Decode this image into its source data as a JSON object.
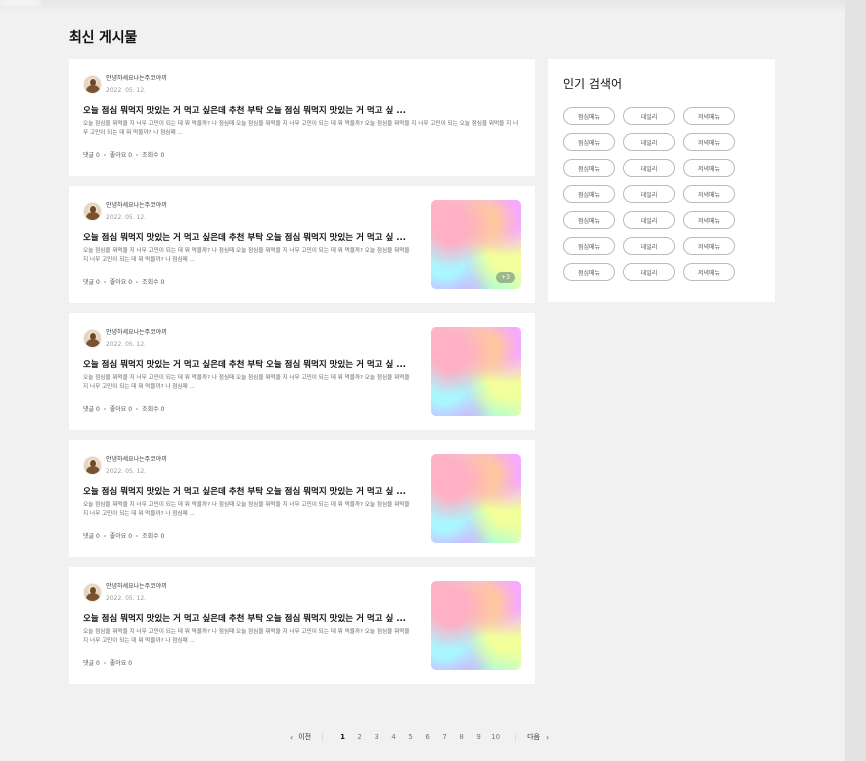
{
  "section_title": "최신 게시물",
  "posts": [
    {
      "author": "안녕하세요나는주코야끼",
      "date": "2022. 05. 12.",
      "title": "오늘 점심 뭐먹지 맛있는 거 먹고 싶은데 추천 부탁 오늘 점심 뭐먹지 맛있는 거 먹고 싶 ...",
      "excerpt": "오늘 점심을 뭐먹을 지 너무 고민이 되는 데 뭐 먹을까? 나 점심때 오늘 점심을 뭐먹을 지 너무 고민이 되는 데 뭐 먹을까? 오늘 점심을 뭐먹을 지 너무 고민이 되는 오늘 점심을 뭐먹을 지 너무 고민이 되는 데 뭐 먹을까? 나 점심때 ...",
      "comments": "댓글 0",
      "likes": "좋아요 0",
      "views": "조회수 0",
      "has_image": false,
      "extra_images": ""
    },
    {
      "author": "안녕하세요나는주코야끼",
      "date": "2022. 05. 12.",
      "title": "오늘 점심 뭐먹지 맛있는 거 먹고 싶은데 추천 부탁 오늘 점심 뭐먹지 맛있는 거 먹고 싶 ...",
      "excerpt": "오늘 점심을 뭐먹을 지 너무 고민이 되는 데 뭐 먹을까? 나 점심때 오늘 점심을 뭐먹을 지 너무 고민이 되는 데 뭐 먹을까? 오늘 점심을 뭐먹을 지 너무 고민이 되는 데 뭐 먹을까? 나 점심때 ...",
      "comments": "댓글 0",
      "likes": "좋아요 0",
      "views": "조회수 0",
      "has_image": true,
      "extra_images": "+3"
    },
    {
      "author": "안녕하세요나는주코야끼",
      "date": "2022. 05. 12.",
      "title": "오늘 점심 뭐먹지 맛있는 거 먹고 싶은데 추천 부탁 오늘 점심 뭐먹지 맛있는 거 먹고 싶 ...",
      "excerpt": "오늘 점심을 뭐먹을 지 너무 고민이 되는 데 뭐 먹을까? 나 점심때 오늘 점심을 뭐먹을 지 너무 고민이 되는 데 뭐 먹을까? 오늘 점심을 뭐먹을 지 너무 고민이 되는 데 뭐 먹을까? 나 점심때 ...",
      "comments": "댓글 0",
      "likes": "좋아요 0",
      "views": "조회수 0",
      "has_image": true,
      "extra_images": ""
    },
    {
      "author": "안녕하세요나는주코야끼",
      "date": "2022. 05. 12.",
      "title": "오늘 점심 뭐먹지 맛있는 거 먹고 싶은데 추천 부탁 오늘 점심 뭐먹지 맛있는 거 먹고 싶 ...",
      "excerpt": "오늘 점심을 뭐먹을 지 너무 고민이 되는 데 뭐 먹을까? 나 점심때 오늘 점심을 뭐먹을 지 너무 고민이 되는 데 뭐 먹을까? 오늘 점심을 뭐먹을 지 너무 고민이 되는 데 뭐 먹을까? 나 점심때 ...",
      "comments": "댓글 0",
      "likes": "좋아요 0",
      "views": "조회수 0",
      "has_image": true,
      "extra_images": ""
    },
    {
      "author": "안녕하세요나는주코야끼",
      "date": "2022. 05. 12.",
      "title": "오늘 점심 뭐먹지 맛있는 거 먹고 싶은데 추천 부탁 오늘 점심 뭐먹지 맛있는 거 먹고 싶 ...",
      "excerpt": "오늘 점심을 뭐먹을 지 너무 고민이 되는 데 뭐 먹을까? 나 점심때 오늘 점심을 뭐먹을 지 너무 고민이 되는 데 뭐 먹을까? 오늘 점심을 뭐먹을 지 너무 고민이 되는 데 뭐 먹을까? 나 점심때 ...",
      "comments": "댓글 0",
      "likes": "좋아요 0",
      "views": "",
      "has_image": true,
      "extra_images": ""
    }
  ],
  "sidebar": {
    "title": "인기 검색어",
    "tags": [
      "점심메뉴",
      "데일리",
      "저녁메뉴",
      "점심메뉴",
      "데일리",
      "저녁메뉴",
      "점심메뉴",
      "데일리",
      "저녁메뉴",
      "점심메뉴",
      "데일리",
      "저녁메뉴",
      "점심메뉴",
      "데일리",
      "저녁메뉴",
      "점심메뉴",
      "데일리",
      "저녁메뉴",
      "점심메뉴",
      "데일리",
      "저녁메뉴"
    ]
  },
  "pagination": {
    "prev_label": "이전",
    "next_label": "다음",
    "pages": [
      "1",
      "2",
      "3",
      "4",
      "5",
      "6",
      "7",
      "8",
      "9",
      "10"
    ],
    "current_page": "1"
  }
}
